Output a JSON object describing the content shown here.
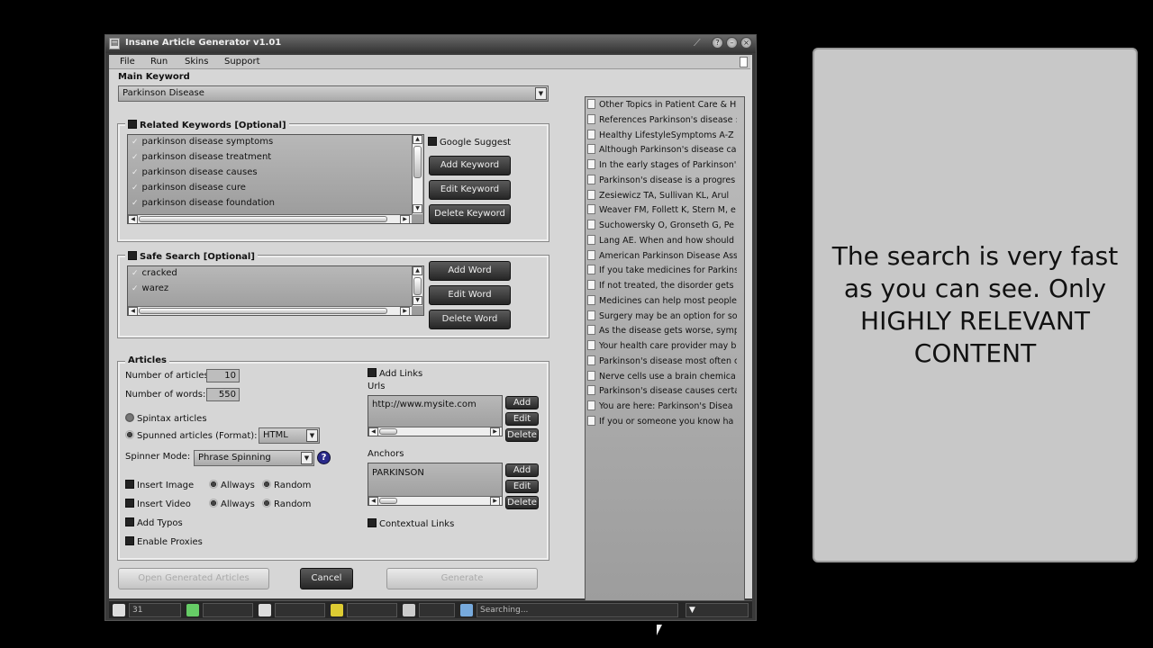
{
  "window": {
    "title": "Insane Article Generator v1.01"
  },
  "menu": [
    "File",
    "Run",
    "Skins",
    "Support"
  ],
  "main_keyword": {
    "label": "Main Keyword",
    "value": "Parkinson Disease"
  },
  "related": {
    "title": "Related Keywords [Optional]",
    "items": [
      "parkinson disease symptoms",
      "parkinson disease treatment",
      "parkinson disease causes",
      "parkinson disease cure",
      "parkinson disease foundation"
    ],
    "google_suggest": "Google Suggest",
    "add_button": "Add Keyword",
    "edit_button": "Edit Keyword",
    "delete_button": "Delete Keyword"
  },
  "safe": {
    "title": "Safe Search [Optional]",
    "items": [
      "cracked",
      "warez"
    ],
    "add_button": "Add Word",
    "edit_button": "Edit Word",
    "delete_button": "Delete Word"
  },
  "articles": {
    "title": "Articles",
    "num_articles_label": "Number of articles",
    "num_articles": "10",
    "num_words_label": "Number of words:",
    "num_words": "550",
    "spintax": "Spintax articles",
    "spunned": "Spunned articles (Format):",
    "format": "HTML",
    "spinner_mode_label": "Spinner Mode:",
    "spinner_mode": "Phrase Spinning",
    "help": "?",
    "insert_image": "Insert Image",
    "insert_video": "Insert Video",
    "always": "Allways",
    "random": "Random",
    "add_typos": "Add Typos",
    "enable_proxies": "Enable Proxies",
    "add_links": "Add Links",
    "urls_label": "Urls",
    "url_value": "http://www.mysite.com",
    "anchors_label": "Anchors",
    "anchor_value": "PARKINSON",
    "add": "Add",
    "edit": "Edit",
    "delete": "Delete",
    "contextual_links": "Contextual Links"
  },
  "bottom": {
    "left_button": "Open Generated Articles",
    "cancel": "Cancel",
    "right_button": "Generate"
  },
  "results": [
    "Other Topics in Patient Care & H",
    "References Parkinson's disease :",
    "Healthy LifestyleSymptoms A-Z",
    "Although Parkinson's disease ca",
    "In the early stages of Parkinson's",
    "Parkinson's disease is a progres",
    "Zesiewicz TA, Sullivan KL, Arul",
    "Weaver FM, Follett K, Stern M, e",
    "Suchowersky O, Gronseth G, Pe",
    "Lang AE. When and how should",
    "American Parkinson Disease Ass",
    "If you take medicines for Parkins",
    "If not treated, the disorder gets",
    "Medicines can help most people",
    "Surgery may be an option for so",
    "As the disease gets worse, symp",
    "Your health care provider may b",
    "Parkinson's disease most often c",
    "Nerve cells use a brain chemica",
    "Parkinson's disease causes certa",
    "You are here: Parkinson's Disea",
    "If you or someone you know ha"
  ],
  "status": {
    "count": "31",
    "state": "Searching..."
  },
  "callout": "The search is very fast as you can see. Only HIGHLY RELEVANT CONTENT",
  "colors": {
    "window_bg": "#d6d6d6",
    "dark_button": "#333333",
    "callout_bg": "#c8c8c8"
  }
}
